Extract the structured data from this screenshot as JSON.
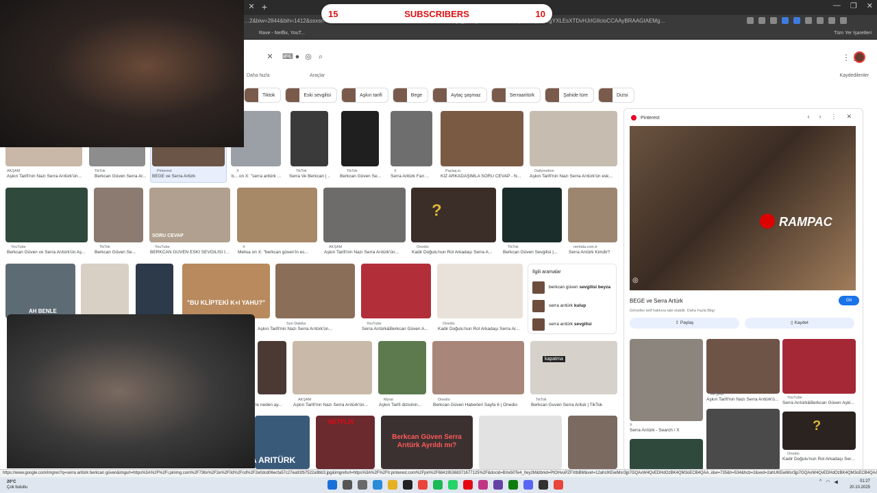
{
  "browser": {
    "url": "…2&biw=2844&bih=1412&ssxsrf=AE3T…",
    "url_tail": "…rk+ber&gs_lp=Egtnd3Mtd2l6LWltZyITc2VycmEgYXLEsXTDvHJrIGIlcioCCAAyBRAAGIAEMg…",
    "bookmark_rave": "Rave - Netflix, YouT...",
    "bookmark_all": "Tüm Yer İşaretleri"
  },
  "subscribers": {
    "left_count": "15",
    "label": "SUBSCRIBERS",
    "right_count": "10"
  },
  "google": {
    "filter_more": "Daha fazla",
    "filter_tools": "Araçlar",
    "saved": "Kaydedilenler",
    "chips": [
      "Tiktok",
      "Eski sevgilisi",
      "Aşkın tarifi",
      "Bege",
      "Aytaç şaşmaz",
      "Serraaritürk",
      "Şahide türe",
      "Dizisi"
    ]
  },
  "row1": [
    {
      "src": "AKŞAM",
      "cap": "Aşkın Tarifi'nin Nazı Serra Arıtürk'ün..."
    },
    {
      "src": "TikTok",
      "cap": "Berkcan Güven Serra Ar..."
    },
    {
      "src": "Pinterest",
      "cap": "BEGE ve Serra Artürk"
    },
    {
      "src": "X",
      "cap": "b... on X: \"serra aritürk ..."
    },
    {
      "src": "TikTok",
      "cap": "Serra Ve Berkcan | ..."
    },
    {
      "src": "TikTok",
      "cap": "Berkcan Güven Se..."
    },
    {
      "src": "X",
      "cap": "Serra Aritürk Fan ..."
    },
    {
      "src": "Paylaş.io",
      "cap": "KIZ ARKADAŞIMLA SORU CEVAP - N..."
    },
    {
      "src": "Dailymotion",
      "cap": "Aşkın Tarifi'nin Nazı Serra Arıtürk'ün esk..."
    }
  ],
  "row2": [
    {
      "src": "YouTube",
      "cap": "Berkcan Güven ve Serra Arıtürk'ün Aş..."
    },
    {
      "src": "TikTok",
      "cap": "Berkcan Güven Se..."
    },
    {
      "src": "YouTube",
      "cap": "BERKCAN GÜVEN ESKİ SEVGİLİSİ İ..."
    },
    {
      "src": "X",
      "cap": "Melisa on X: \"berkcan güven'in es..."
    },
    {
      "src": "AKŞAM",
      "cap": "Aşkın Tarifi'nin Nazı Serra Arıtürk'ün..."
    },
    {
      "src": "Onedio",
      "cap": "Kadir Doğulu'nun Rol Arkadaşı Serra A..."
    },
    {
      "src": "TikTok",
      "cap": "Berkcan Güven Sevgilisi |..."
    },
    {
      "src": "nerkida.com.tr",
      "cap": "Serra Arıtürk Kimdir?"
    }
  ],
  "row3": [
    {
      "src": "Son Dakika",
      "cap": "Aşkın Tarifi'nin Nazı Serra Arıtürk'ün..."
    },
    {
      "src": "YouTube",
      "cap": "Serra Arıtürk&Berkcan Güven A..."
    },
    {
      "src": "Onedio",
      "cap": "Kadir Doğulu'nun Rol Arkadaşı Serra Ar..."
    }
  ],
  "row4": [
    {
      "src": "",
      "cap": "le neden ay..."
    },
    {
      "src": "AKŞAM",
      "cap": "Aşkın Tarifi'nin Nazı Serra Arıtürk'ün..."
    },
    {
      "src": "Myrat",
      "cap": "Aşkın Tarifi dizisinin..."
    },
    {
      "src": "Onedio",
      "cap": "Berkcan Güven Haberleri Sayfa 6 | Onedio"
    },
    {
      "src": "TikTok",
      "cap": "Berkcan Guven Serra Arituk | TikTok"
    }
  ],
  "overlay_texts": {
    "ah_benle": "AH BENLE",
    "bu_klipteki": "\"BU KLİPTEKİ K+I YAHU?\"",
    "soru_cevap": "SORU CEVAP",
    "kapatma": "kapatma",
    "berkcan_thumb": "Berkcan Güven Serra Arıtürk Ayrıldı mı?",
    "aritürk_thumb": "A ARITÜRK",
    "netflix": "NETFLIX"
  },
  "related": {
    "title": "İlgili aramalar",
    "items": [
      {
        "prefix": "berkcan güven ",
        "bold": "sevgilisi beyza"
      },
      {
        "prefix": "serra arıtürk ",
        "bold": "kulup"
      },
      {
        "prefix": "serra arıtürk ",
        "bold": "sevgilisi"
      }
    ]
  },
  "panel": {
    "source": "Pinterest",
    "title": "BEGE ve Serra Artürk",
    "note": "Görseller telif hakkına tabi olabilir. Daha Fazla Bilgi",
    "go_button": "Git",
    "share": "Paylaş",
    "save": "Kaydet",
    "watermark": "RAMPAC",
    "thumbs": [
      {
        "src": "X",
        "cap": "Serra Arıtürk - Search / X"
      },
      {
        "src": "AKŞAM",
        "cap": "Aşkın Tarifi'nin Nazı Serra Arıtürk'ü..."
      },
      {
        "src": "YouTube",
        "cap": "Serra Arıtürk&Berkcan Güven Aşki..."
      },
      {
        "src": "Onedio",
        "cap": "Kadir Doğulu'nun Rol Arkadaşı Ser..."
      }
    ]
  },
  "statusbar": "https://www.google.com/imgres?q=serra aritürk berkcan güven&imgurl=https%3A%2F%2Fi.pinimg.com%2F736x%2F2e%2F0d%2Fcd%2F2e0dcd06ecfa57c27ea91fb7522a9bb3.jpg&imgrefurl=https%3A%2F%2Ftr.pinterest.com%2Fpin%2F684195368371677125%2F&docid=BXe50Te4_0ey2M&tbnid=PtOHvuPZFXtbBM&vet=12ahUKEwiMsr3jp7GQAxW4QvEDHdOzBK4QM3oECB4QAA..i&w=735&h=534&hcb=2&ved=2ahUKEwiMsr3jp7GQAxW4QvEDHdOzBK4QM3oECB4QAA",
  "taskbar": {
    "temp": "20°C",
    "weather": "Çok bulutlu",
    "time": "01:27",
    "date": "20.10.2025"
  },
  "colors": {
    "accent": "#1a73e8",
    "subs_red": "#dd1111",
    "taskbar": "#dfe6ef"
  }
}
